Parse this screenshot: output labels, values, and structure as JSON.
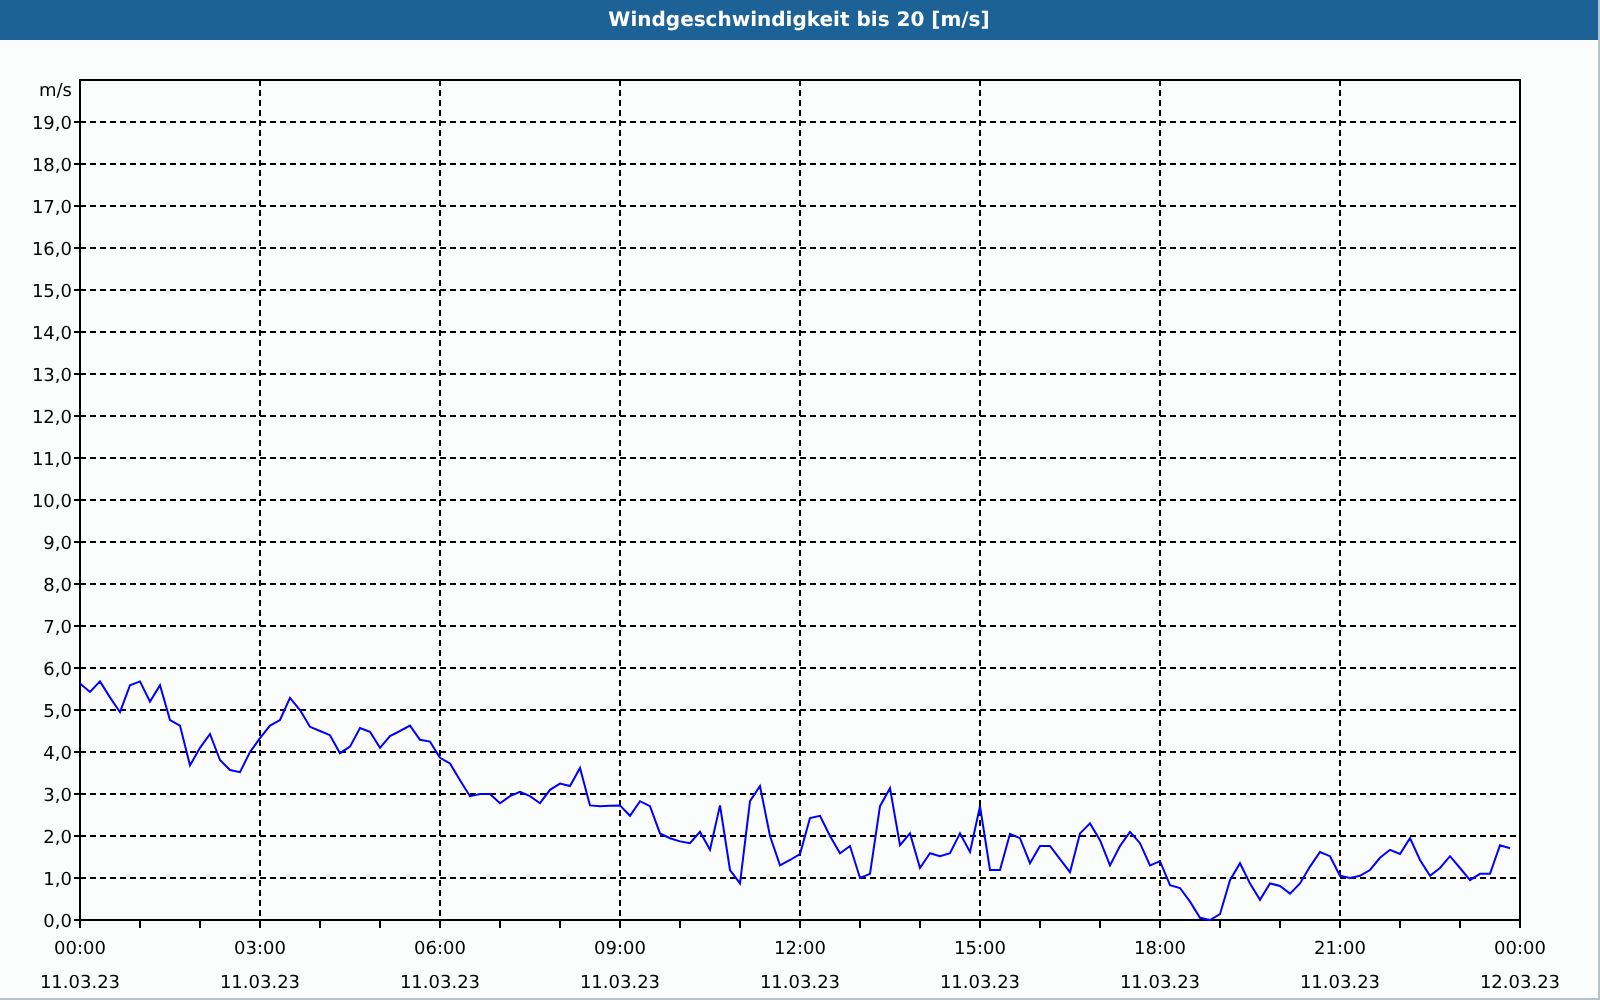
{
  "chart_data": {
    "type": "line",
    "title": "Windgeschwindigkeit bis 20 [m/s]",
    "ylabel": "m/s",
    "grid": true,
    "ylim": [
      0,
      20
    ],
    "yticks": [
      {
        "value": 0,
        "label": "0,0"
      },
      {
        "value": 1,
        "label": "1,0"
      },
      {
        "value": 2,
        "label": "2,0"
      },
      {
        "value": 3,
        "label": "3,0"
      },
      {
        "value": 4,
        "label": "4,0"
      },
      {
        "value": 5,
        "label": "5,0"
      },
      {
        "value": 6,
        "label": "6,0"
      },
      {
        "value": 7,
        "label": "7,0"
      },
      {
        "value": 8,
        "label": "8,0"
      },
      {
        "value": 9,
        "label": "9,0"
      },
      {
        "value": 10,
        "label": "10,0"
      },
      {
        "value": 11,
        "label": "11,0"
      },
      {
        "value": 12,
        "label": "12,0"
      },
      {
        "value": 13,
        "label": "13,0"
      },
      {
        "value": 14,
        "label": "14,0"
      },
      {
        "value": 15,
        "label": "15,0"
      },
      {
        "value": 16,
        "label": "16,0"
      },
      {
        "value": 17,
        "label": "17,0"
      },
      {
        "value": 18,
        "label": "18,0"
      },
      {
        "value": 19,
        "label": "19,0"
      }
    ],
    "categories": [
      "00:00\n11.03.23",
      null,
      null,
      null,
      null,
      null,
      null,
      null,
      null,
      null,
      null,
      null,
      null,
      null,
      null,
      null,
      null,
      null,
      "03:00\n11.03.23",
      null,
      null,
      null,
      null,
      null,
      null,
      null,
      null,
      null,
      null,
      null,
      null,
      null,
      null,
      null,
      null,
      null,
      "06:00\n11.03.23",
      null,
      null,
      null,
      null,
      null,
      null,
      null,
      null,
      null,
      null,
      null,
      null,
      null,
      null,
      null,
      null,
      null,
      "09:00\n11.03.23",
      null,
      null,
      null,
      null,
      null,
      null,
      null,
      null,
      null,
      null,
      null,
      null,
      null,
      null,
      null,
      null,
      null,
      "12:00\n11.03.23",
      null,
      null,
      null,
      null,
      null,
      null,
      null,
      null,
      null,
      null,
      null,
      null,
      null,
      null,
      null,
      null,
      null,
      "15:00\n11.03.23",
      null,
      null,
      null,
      null,
      null,
      null,
      null,
      null,
      null,
      null,
      null,
      null,
      null,
      null,
      null,
      null,
      null,
      "18:00\n11.03.23",
      null,
      null,
      null,
      null,
      null,
      null,
      null,
      null,
      null,
      null,
      null,
      null,
      null,
      null,
      null,
      null,
      null,
      "21:00\n11.03.23",
      null,
      null,
      null,
      null,
      null,
      null,
      null,
      null,
      null,
      null,
      null,
      null,
      null,
      null,
      null,
      null,
      null,
      "00:00\n12.03.23"
    ],
    "series": [
      {
        "color": "#0000ff",
        "values": [
          5.63,
          5.43,
          5.68,
          5.3,
          4.95,
          5.59,
          5.68,
          5.2,
          5.59,
          4.76,
          4.63,
          3.68,
          4.1,
          4.43,
          3.81,
          3.57,
          3.52,
          4.0,
          4.33,
          4.63,
          4.76,
          5.29,
          5.0,
          4.6,
          4.5,
          4.4,
          3.97,
          4.13,
          4.57,
          4.48,
          4.1,
          4.38,
          4.5,
          4.63,
          4.29,
          4.25,
          3.86,
          3.73,
          3.33,
          2.95,
          3.0,
          3.0,
          2.78,
          2.95,
          3.05,
          2.95,
          2.78,
          3.1,
          3.25,
          3.19,
          3.62,
          2.73,
          2.71,
          2.72,
          2.73,
          2.48,
          2.83,
          2.71,
          2.06,
          1.95,
          1.87,
          1.83,
          2.1,
          1.67,
          2.73,
          1.19,
          0.87,
          2.83,
          3.19,
          2.0,
          1.3,
          1.43,
          1.57,
          2.43,
          2.48,
          2.0,
          1.59,
          1.76,
          1.0,
          1.1,
          2.71,
          3.14,
          1.78,
          2.06,
          1.24,
          1.59,
          1.52,
          1.59,
          2.06,
          1.62,
          2.71,
          1.19,
          1.19,
          2.05,
          1.95,
          1.35,
          1.76,
          1.76,
          1.45,
          1.14,
          2.06,
          2.3,
          1.9,
          1.3,
          1.76,
          2.1,
          1.83,
          1.3,
          1.4,
          0.83,
          0.76,
          0.44,
          0.05,
          0.0,
          0.14,
          0.95,
          1.35,
          0.87,
          0.48,
          0.87,
          0.81,
          0.63,
          0.87,
          1.27,
          1.62,
          1.52,
          1.05,
          1.0,
          1.05,
          1.19,
          1.48,
          1.67,
          1.57,
          1.95,
          1.43,
          1.05,
          1.24,
          1.52,
          1.24,
          0.95,
          1.1,
          1.1,
          1.78,
          1.71,
          null
        ]
      }
    ]
  }
}
